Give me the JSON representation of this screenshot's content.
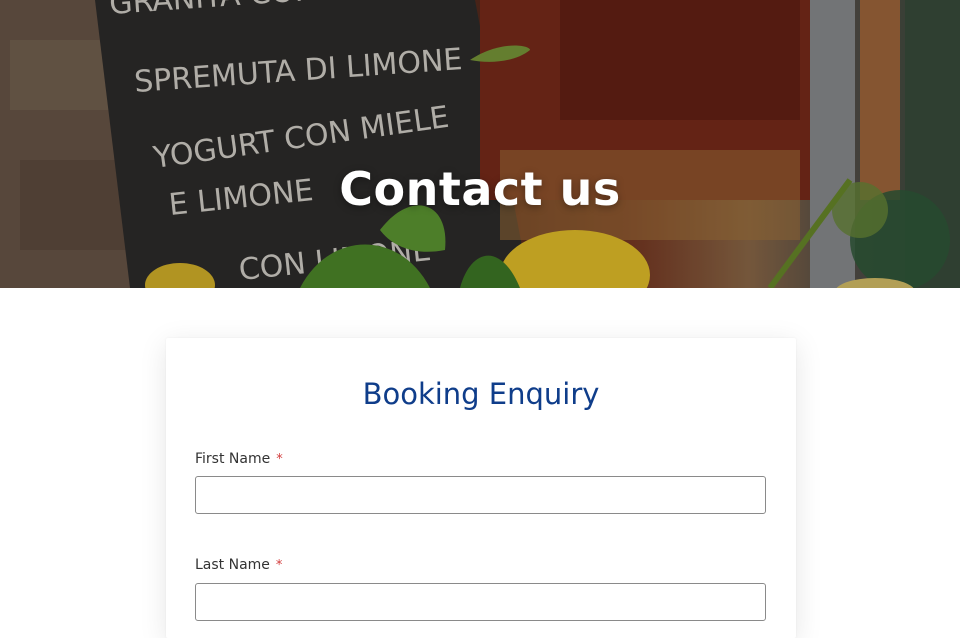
{
  "hero": {
    "title": "Contact us",
    "chalkboard_lines": [
      "GRANITA CON VOGRA",
      "SPREMUTA DI LIMONE",
      "YOGURT CON MIELE",
      "E LIMONE",
      "CON LIMONE"
    ]
  },
  "form": {
    "title": "Booking Enquiry",
    "required_marker": "*",
    "fields": [
      {
        "label": "First Name",
        "value": "",
        "placeholder": ""
      },
      {
        "label": "Last Name",
        "value": "",
        "placeholder": ""
      }
    ]
  },
  "colors": {
    "form_title": "#0f3d8a",
    "required": "#d23a3a",
    "input_border": "#8a8a8a"
  }
}
